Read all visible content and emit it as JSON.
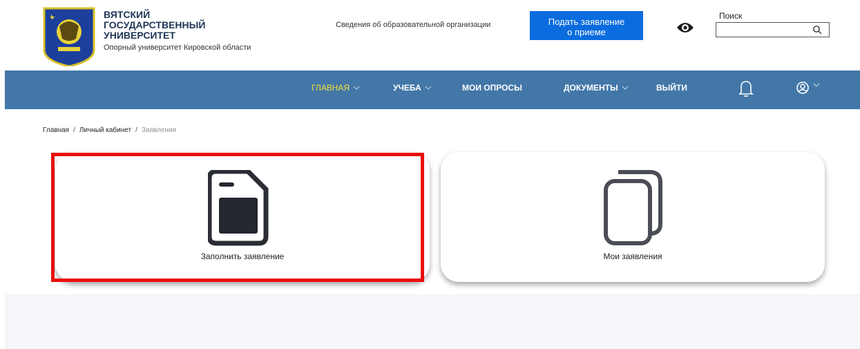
{
  "header": {
    "brand_title": "ВЯТСКИЙ\nГОСУДАРСТВЕННЫЙ\nУНИВЕРСИТЕТ",
    "brand_subtitle": "Опорный университет Кировской области",
    "org_info_link": "Сведения об образовательной организации",
    "apply_button": "Подать заявление\nо приеме",
    "accessibility_icon": "eye-icon",
    "search_label": "Поиск",
    "search_value": "",
    "search_placeholder": ""
  },
  "nav": {
    "items": [
      {
        "label": "ГЛАВНАЯ",
        "has_dropdown": true,
        "active": true
      },
      {
        "label": "УЧЕБА",
        "has_dropdown": true,
        "active": false
      },
      {
        "label": "МОИ ОПРОСЫ",
        "has_dropdown": false,
        "active": false
      },
      {
        "label": "ДОКУМЕНТЫ",
        "has_dropdown": true,
        "active": false
      },
      {
        "label": "ВЫЙТИ",
        "has_dropdown": false,
        "active": false
      }
    ],
    "notification_icon": "bell-icon",
    "user_icon": "user-circle-icon"
  },
  "breadcrumb": {
    "items": [
      "Главная",
      "Личный кабинет"
    ],
    "current": "Заявления"
  },
  "cards": [
    {
      "label": "Заполнить заявление",
      "icon": "document-icon"
    },
    {
      "label": "Мои заявления",
      "icon": "documents-stack-icon"
    }
  ],
  "colors": {
    "navbar": "#4377a8",
    "active_nav": "#f2e23a",
    "apply_button": "#0a6cde",
    "highlight": "#ea0c0c"
  }
}
